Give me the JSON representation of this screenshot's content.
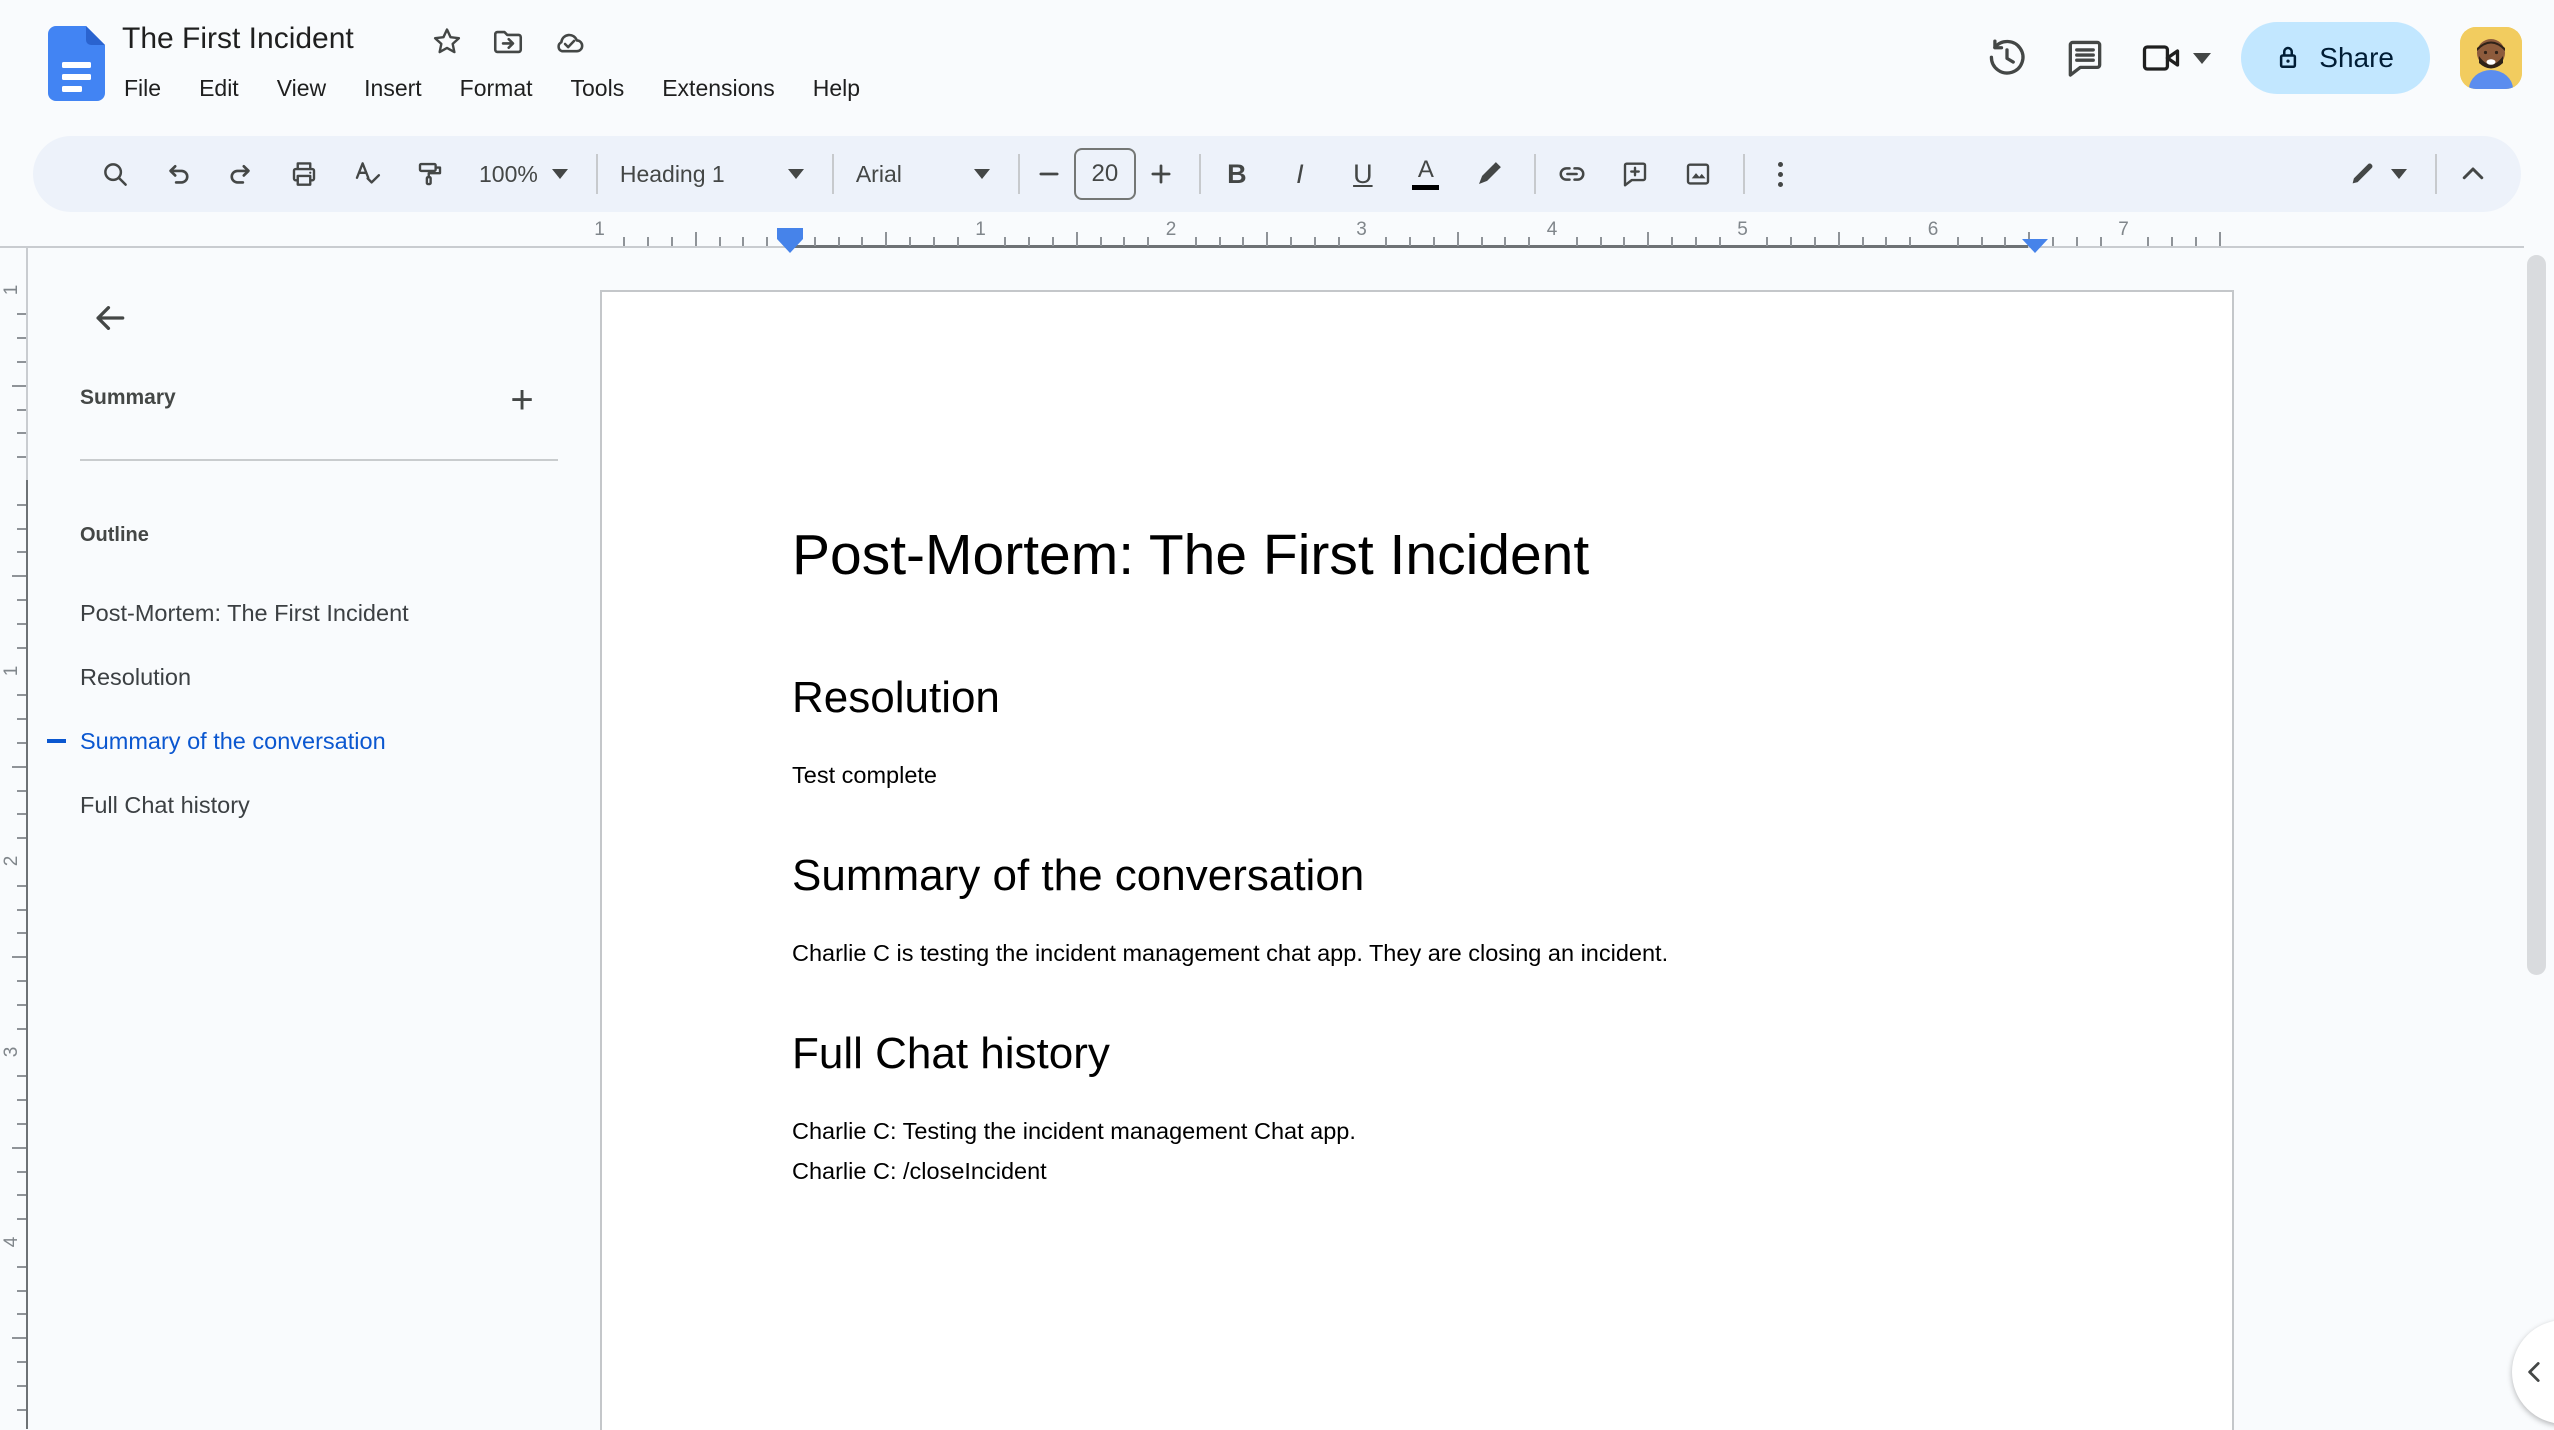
{
  "header": {
    "doc_title": "The First Incident",
    "menu": [
      "File",
      "Edit",
      "View",
      "Insert",
      "Format",
      "Tools",
      "Extensions",
      "Help"
    ],
    "share_label": "Share"
  },
  "toolbar": {
    "zoom": "100%",
    "style": "Heading 1",
    "font": "Arial",
    "font_size": "20",
    "bold": "B",
    "italic": "I",
    "underline": "U",
    "text_color": "A"
  },
  "ruler": {
    "horizontal": {
      "labels": [
        "1",
        "1",
        "2",
        "3",
        "4",
        "5",
        "6",
        "7"
      ],
      "inches": [
        -1,
        1,
        2,
        3,
        4,
        5,
        6,
        7
      ]
    },
    "vertical": {
      "labels": [
        "1",
        "1",
        "2",
        "3",
        "4"
      ],
      "inches": [
        -1,
        1,
        2,
        3,
        4
      ]
    }
  },
  "sidebar": {
    "summary_label": "Summary",
    "outline_label": "Outline",
    "items": [
      "Post-Mortem: The First Incident",
      "Resolution",
      "Summary of the conversation",
      "Full Chat history"
    ],
    "active_index": 2
  },
  "document": {
    "title": "Post-Mortem: The First Incident",
    "sections": [
      {
        "heading": "Resolution",
        "paragraphs": [
          "Test complete"
        ]
      },
      {
        "heading": "Summary of the conversation",
        "paragraphs": [
          "Charlie C is testing the incident management chat app. They are closing an incident."
        ]
      },
      {
        "heading": "Full Chat history",
        "paragraphs": [
          "Charlie C: Testing the incident management Chat app.",
          "Charlie C: /closeIncident"
        ]
      }
    ]
  },
  "colors": {
    "accent_blue": "#0b57d0",
    "share_bg": "#c2e7ff",
    "share_text": "#001d35",
    "toolbar_bg": "#edf2fa",
    "icon_gray": "#444746",
    "ruler_marker_blue": "#4683ea",
    "docs_icon_blue": "#4284f3",
    "avatar_bg": "#f2cc5f"
  }
}
